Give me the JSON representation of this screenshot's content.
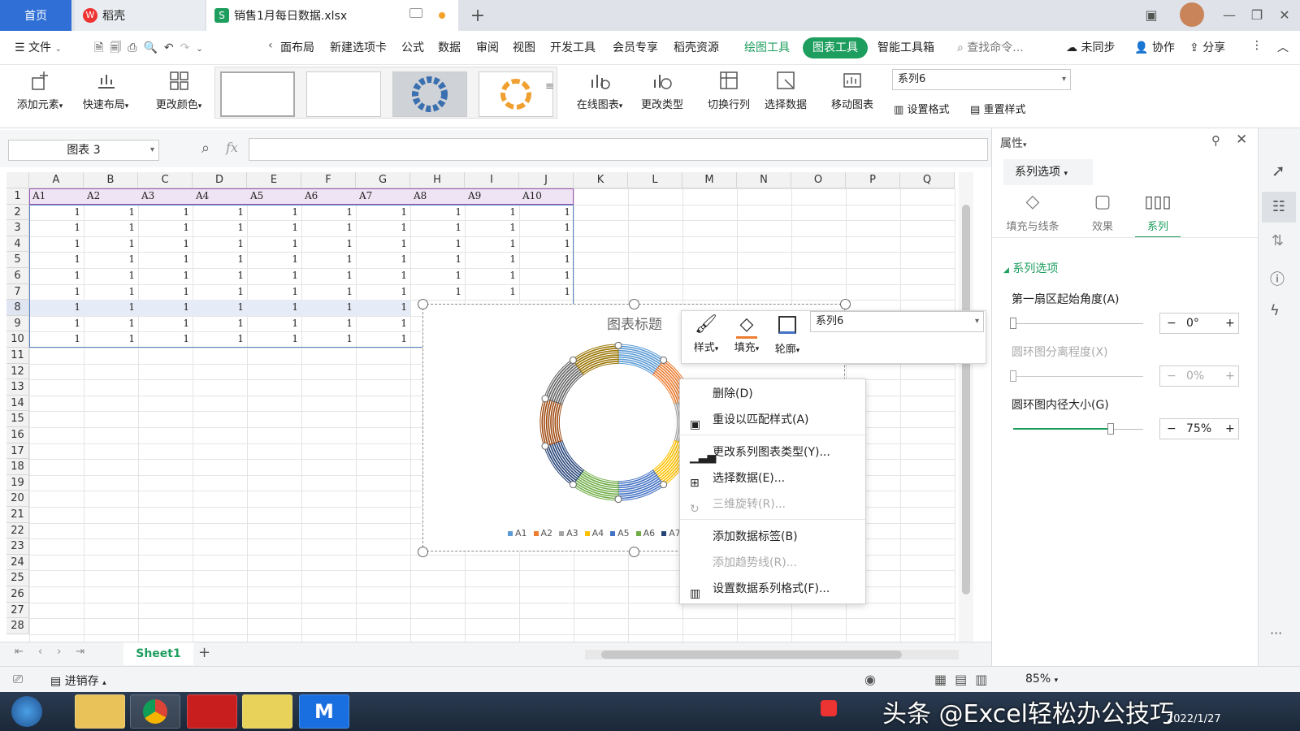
{
  "title_tabs": {
    "home": "首页",
    "daoke": "稻壳",
    "file_badge": "S",
    "file": "销售1月每日数据.xlsx"
  },
  "menu": {
    "file": "文件",
    "items": [
      "面布局",
      "新建选项卡",
      "公式",
      "数据",
      "审阅",
      "视图",
      "开发工具",
      "会员专享",
      "稻壳资源"
    ],
    "draw_tools": "绘图工具",
    "chart_tools": "图表工具",
    "smart_tools": "智能工具箱",
    "search": "查找命令...",
    "unsynced": "未同步",
    "collab": "协作",
    "share": "分享"
  },
  "ribbon": {
    "add_element": "添加元素",
    "quick_layout": "快速布局",
    "change_color": "更改颜色",
    "online_chart": "在线图表",
    "change_type": "更改类型",
    "switch_rowcol": "切换行列",
    "select_data": "选择数据",
    "move_chart": "移动图表",
    "series_select": "系列6",
    "set_format": "设置格式",
    "reset_style": "重置样式"
  },
  "formula_bar": {
    "name_box": "图表 3",
    "fx": "fx"
  },
  "grid": {
    "columns": [
      "A",
      "B",
      "C",
      "D",
      "E",
      "F",
      "G",
      "H",
      "I",
      "J",
      "K",
      "L",
      "M",
      "N",
      "O",
      "P",
      "Q"
    ],
    "rows": [
      "1",
      "2",
      "3",
      "4",
      "5",
      "6",
      "7",
      "8",
      "9",
      "10",
      "11",
      "12",
      "13",
      "14",
      "15",
      "16",
      "17",
      "18",
      "19",
      "20",
      "21",
      "22",
      "23",
      "24",
      "25",
      "26",
      "27",
      "28"
    ],
    "header_row": [
      "A1",
      "A2",
      "A3",
      "A4",
      "A5",
      "A6",
      "A7",
      "A8",
      "A9",
      "A10"
    ],
    "cell_value": "1"
  },
  "chart": {
    "title": "图表标题",
    "legend": [
      "A1",
      "A2",
      "A3",
      "A4",
      "A5",
      "A6",
      "A7"
    ],
    "inner_radius_percent": 75
  },
  "chart_data": {
    "type": "doughnut",
    "title": "图表标题",
    "categories": [
      "A1",
      "A2",
      "A3",
      "A4",
      "A5",
      "A6",
      "A7",
      "A8",
      "A9",
      "A10"
    ],
    "series": [
      {
        "values": [
          1,
          1,
          1,
          1,
          1,
          1,
          1,
          1,
          1,
          1
        ]
      },
      {
        "values": [
          1,
          1,
          1,
          1,
          1,
          1,
          1,
          1,
          1,
          1
        ]
      },
      {
        "values": [
          1,
          1,
          1,
          1,
          1,
          1,
          1,
          1,
          1,
          1
        ]
      },
      {
        "values": [
          1,
          1,
          1,
          1,
          1,
          1,
          1,
          1,
          1,
          1
        ]
      },
      {
        "values": [
          1,
          1,
          1,
          1,
          1,
          1,
          1,
          1,
          1,
          1
        ]
      },
      {
        "values": [
          1,
          1,
          1,
          1,
          1,
          1,
          1,
          1,
          1,
          1
        ]
      },
      {
        "values": [
          1,
          1,
          1,
          1,
          1,
          1,
          1,
          1,
          1,
          1
        ]
      },
      {
        "values": [
          1,
          1,
          1,
          1,
          1,
          1,
          1,
          1,
          1,
          1
        ]
      },
      {
        "values": [
          1,
          1,
          1,
          1,
          1,
          1,
          1,
          1,
          1,
          1
        ]
      }
    ],
    "colors": [
      "#5b9bd5",
      "#ed7d31",
      "#a5a5a5",
      "#ffc000",
      "#4472c4",
      "#70ad47",
      "#264478",
      "#9e480e",
      "#636363",
      "#997300"
    ],
    "legend_position": "bottom"
  },
  "float_toolbar": {
    "style": "样式",
    "fill": "填充",
    "outline": "轮廓",
    "series": "系列6"
  },
  "context_menu": {
    "delete": "删除(D)",
    "reset_match": "重设以匹配样式(A)",
    "change_series_type": "更改系列图表类型(Y)...",
    "select_data": "选择数据(E)...",
    "rotate_3d": "三维旋转(R)...",
    "add_labels": "添加数据标签(B)",
    "add_trendline": "添加趋势线(R)...",
    "format_series": "设置数据系列格式(F)..."
  },
  "panel": {
    "title": "属性",
    "dropdown": "系列选项",
    "tabs": [
      "填充与线条",
      "效果",
      "系列"
    ],
    "section": "系列选项",
    "first_angle_label": "第一扇区起始角度(A)",
    "first_angle_value": "0°",
    "explosion_label": "圆环图分离程度(X)",
    "explosion_value": "0%",
    "hole_label": "圆环图内径大小(G)",
    "hole_value": "75%",
    "first_angle_fraction": 0,
    "explosion_fraction": 0,
    "hole_fraction": 0.75
  },
  "sheet": {
    "name": "Sheet1"
  },
  "status": {
    "inventory": "进销存",
    "zoom": "85%"
  },
  "taskbar": {
    "watermark": "头条 @Excel轻松办公技巧",
    "date": "2022/1/27"
  }
}
